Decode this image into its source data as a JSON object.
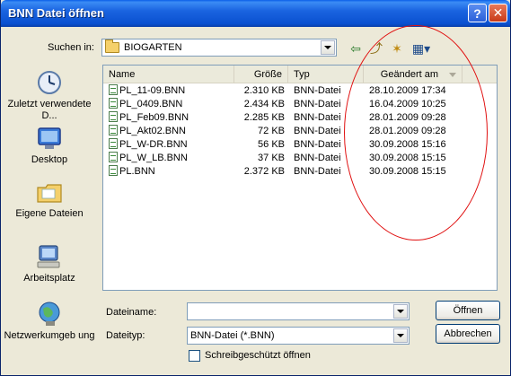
{
  "window": {
    "title": "BNN Datei öffnen",
    "help_label": "?",
    "close_label": "✕"
  },
  "lookin": {
    "label": "Suchen in:",
    "value": "BIOGARTEN"
  },
  "toolbar": {
    "back_icon": "⇦",
    "up_icon": "⤴",
    "newfolder_icon": "✶",
    "views_icon": "▦▾"
  },
  "places": [
    {
      "label": "Zuletzt verwendete D...",
      "icon": "recent-icon"
    },
    {
      "label": "Desktop",
      "icon": "desktop-icon"
    },
    {
      "label": "Eigene Dateien",
      "icon": "documents-icon"
    },
    {
      "label": "Arbeitsplatz",
      "icon": "computer-icon"
    },
    {
      "label": "Netzwerkumgeb ung",
      "icon": "network-icon"
    }
  ],
  "columns": {
    "name": "Name",
    "size": "Größe",
    "type": "Typ",
    "modified": "Geändert am"
  },
  "files": [
    {
      "name": "PL_11-09.BNN",
      "size": "2.310 KB",
      "type": "BNN-Datei",
      "modified": "28.10.2009 17:34"
    },
    {
      "name": "PL_0409.BNN",
      "size": "2.434 KB",
      "type": "BNN-Datei",
      "modified": "16.04.2009 10:25"
    },
    {
      "name": "PL_Feb09.BNN",
      "size": "2.285 KB",
      "type": "BNN-Datei",
      "modified": "28.01.2009 09:28"
    },
    {
      "name": "PL_Akt02.BNN",
      "size": "72 KB",
      "type": "BNN-Datei",
      "modified": "28.01.2009 09:28"
    },
    {
      "name": "PL_W-DR.BNN",
      "size": "56 KB",
      "type": "BNN-Datei",
      "modified": "30.09.2008 15:16"
    },
    {
      "name": "PL_W_LB.BNN",
      "size": "37 KB",
      "type": "BNN-Datei",
      "modified": "30.09.2008 15:15"
    },
    {
      "name": "PL.BNN",
      "size": "2.372 KB",
      "type": "BNN-Datei",
      "modified": "30.09.2008 15:15"
    }
  ],
  "filename": {
    "label": "Dateiname:",
    "value": ""
  },
  "filetype": {
    "label": "Dateityp:",
    "value": "BNN-Datei (*.BNN)"
  },
  "readonly": {
    "label": "Schreibgeschützt öffnen",
    "checked": false
  },
  "buttons": {
    "open": "Öffnen",
    "cancel": "Abbrechen"
  },
  "colors": {
    "title_bar": "#1a64e0",
    "annotation": "#e01010"
  }
}
